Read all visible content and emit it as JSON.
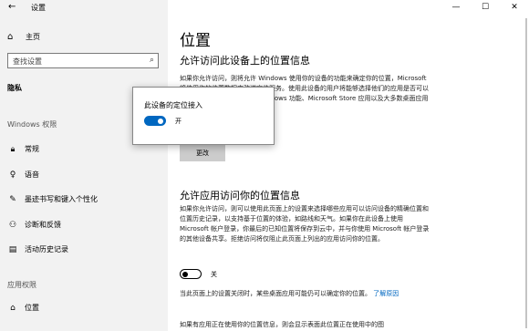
{
  "window": {
    "title": "设置",
    "back_glyph": "←",
    "controls": [
      "—",
      "☐",
      "✕"
    ]
  },
  "sidebar": {
    "home_label": "主页",
    "search_placeholder": "查找设置",
    "category": "隐私",
    "section_windows": "Windows 权限",
    "windows_items": [
      {
        "label": "常规",
        "icon": "lock-icon"
      },
      {
        "label": "语音",
        "icon": "microphone-icon"
      },
      {
        "label": "墨迹书写和键入个性化",
        "icon": "pen-icon"
      },
      {
        "label": "诊断和反馈",
        "icon": "feedback-icon"
      },
      {
        "label": "活动历史记录",
        "icon": "history-icon"
      }
    ],
    "section_app": "应用权限",
    "app_items": [
      {
        "label": "位置",
        "icon": "location-icon"
      }
    ]
  },
  "main": {
    "title": "位置",
    "section1_heading": "允许访问此设备上的位置信息",
    "section1_para": "如果你允许访问，则将允许 Windows 使用你的设备的功能来确定你的位置，Microsoft 将使用你的位置数据来改进定位服务。使用此设备的用户将能够选择他们的应用是否可以访问位置。拒绝访问将阻止 Windows 功能、Microsoft Store 应用以及大多数桌面应用访问位置。",
    "change_button": "更改",
    "section2_heading": "允许应用访问你的位置信息",
    "section2_para": "如果你允许访问，则可以使用此页面上的设置来选择哪些应用可以访问设备的精确位置和位置历史记录，以支持基于位置的体验，如路线和天气。如果你在此设备上使用 Microsoft 帐户登录，你最后的已知位置将保存到云中，并与你使用 Microsoft 帐户登录的其他设备共享。拒绝访问将仅阻止此页面上列出的应用访问你的位置。",
    "app_toggle": {
      "state": "关",
      "on": false
    },
    "note_text": "当此页面上的设置关闭时，某些桌面应用可能仍可以确定你的位置。",
    "note_link": "了解原因",
    "bottom_text": "如果有应用正在使用你的位置信息，则会显示表面此位置正在使用中的图"
  },
  "popup": {
    "title": "此设备的定位接入",
    "toggle": {
      "state": "开",
      "on": true
    }
  },
  "colors": {
    "accent": "#0067c0",
    "sidebar_bg": "#f2f2f2",
    "button_bg": "#cccccc"
  }
}
